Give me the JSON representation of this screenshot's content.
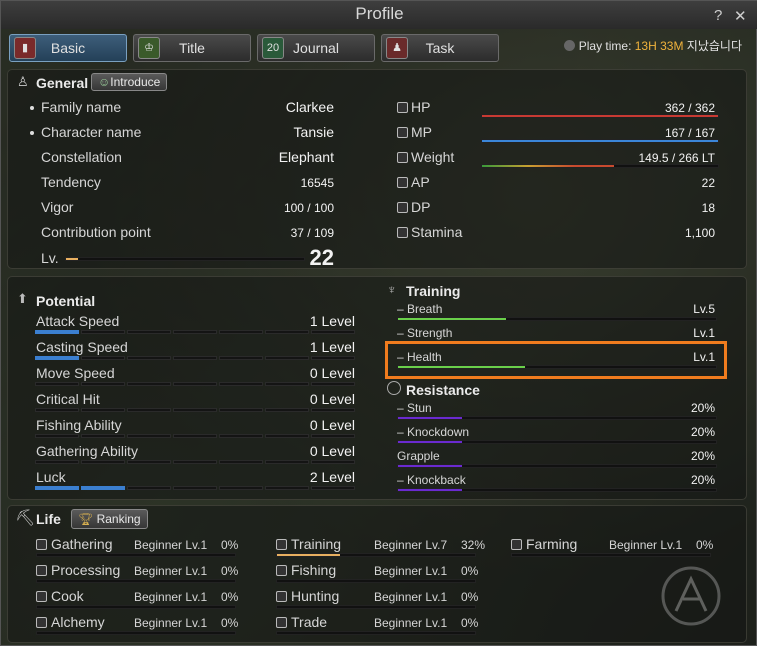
{
  "window": {
    "title": "Profile",
    "help": "?",
    "close": "✕"
  },
  "tabs": [
    {
      "label": "Basic",
      "icon": "book-icon"
    },
    {
      "label": "Title",
      "icon": "medal-icon"
    },
    {
      "label": "Journal",
      "icon": "calendar-icon",
      "icon_text": "20"
    },
    {
      "label": "Task",
      "icon": "person-icon"
    }
  ],
  "playtime": {
    "label": "Play time:",
    "value": "13H 33M",
    "suffix": "지났습니다"
  },
  "general": {
    "title": "General",
    "introduce": "Introduce",
    "info": [
      {
        "label": "Family name",
        "value": "Clarkee"
      },
      {
        "label": "Character name",
        "value": "Tansie"
      },
      {
        "label": "Constellation",
        "value": "Elephant"
      },
      {
        "label": "Tendency",
        "value": "16545"
      },
      {
        "label": "Vigor",
        "value": "100 / 100"
      },
      {
        "label": "Contribution point",
        "value": "37 / 109"
      }
    ],
    "level": {
      "label": "Lv.",
      "value": "22",
      "progress": 0.05
    },
    "stats": [
      {
        "label": "HP",
        "value": "362 / 362",
        "icon": "plus-icon",
        "fill": 1.0,
        "color": "#c83a32"
      },
      {
        "label": "MP",
        "value": "167 / 167",
        "icon": "mp-icon",
        "fill": 1.0,
        "color": "#3b86d8"
      },
      {
        "label": "Weight",
        "value": "149.5 / 266 LT",
        "icon": "weight-icon",
        "fill": 0.56,
        "color": "#c84a2e"
      },
      {
        "label": "AP",
        "value": "22",
        "icon": "sword-icon"
      },
      {
        "label": "DP",
        "value": "18",
        "icon": "shield-icon"
      },
      {
        "label": "Stamina",
        "value": "1,100",
        "icon": "stamina-icon"
      }
    ]
  },
  "potential": {
    "title": "Potential",
    "items": [
      {
        "label": "Attack Speed",
        "value": "1 Level",
        "level": 1
      },
      {
        "label": "Casting Speed",
        "value": "1 Level",
        "level": 1
      },
      {
        "label": "Move Speed",
        "value": "0 Level",
        "level": 0
      },
      {
        "label": "Critical Hit",
        "value": "0 Level",
        "level": 0
      },
      {
        "label": "Fishing Ability",
        "value": "0 Level",
        "level": 0
      },
      {
        "label": "Gathering Ability",
        "value": "0 Level",
        "level": 0
      },
      {
        "label": "Luck",
        "value": "2 Level",
        "level": 2
      }
    ]
  },
  "training": {
    "title": "Training",
    "items": [
      {
        "label": "– Breath",
        "value": "Lv.5",
        "fill": 0.34
      },
      {
        "label": "– Strength",
        "value": "Lv.1",
        "fill": 0.0
      },
      {
        "label": "– Health",
        "value": "Lv.1",
        "fill": 0.4
      }
    ]
  },
  "resistance": {
    "title": "Resistance",
    "items": [
      {
        "label": "– Stun",
        "value": "20%",
        "fill": 0.2
      },
      {
        "label": "– Knockdown",
        "value": "20%",
        "fill": 0.2
      },
      {
        "label": "Grapple",
        "value": "20%",
        "fill": 0.2
      },
      {
        "label": "– Knockback",
        "value": "20%",
        "fill": 0.2
      }
    ]
  },
  "life": {
    "title": "Life",
    "ranking": "Ranking",
    "skills": [
      {
        "label": "Gathering",
        "rank": "Beginner Lv.1",
        "pct": "0%",
        "fill": 0
      },
      {
        "label": "Processing",
        "rank": "Beginner Lv.1",
        "pct": "0%",
        "fill": 0
      },
      {
        "label": "Cook",
        "rank": "Beginner Lv.1",
        "pct": "0%",
        "fill": 0
      },
      {
        "label": "Alchemy",
        "rank": "Beginner Lv.1",
        "pct": "0%",
        "fill": 0
      },
      {
        "label": "Training",
        "rank": "Beginner Lv.7",
        "pct": "32%",
        "fill": 0.32
      },
      {
        "label": "Fishing",
        "rank": "Beginner Lv.1",
        "pct": "0%",
        "fill": 0
      },
      {
        "label": "Hunting",
        "rank": "Beginner Lv.1",
        "pct": "0%",
        "fill": 0
      },
      {
        "label": "Trade",
        "rank": "Beginner Lv.1",
        "pct": "0%",
        "fill": 0
      },
      {
        "label": "Farming",
        "rank": "Beginner Lv.1",
        "pct": "0%",
        "fill": 0
      }
    ]
  }
}
